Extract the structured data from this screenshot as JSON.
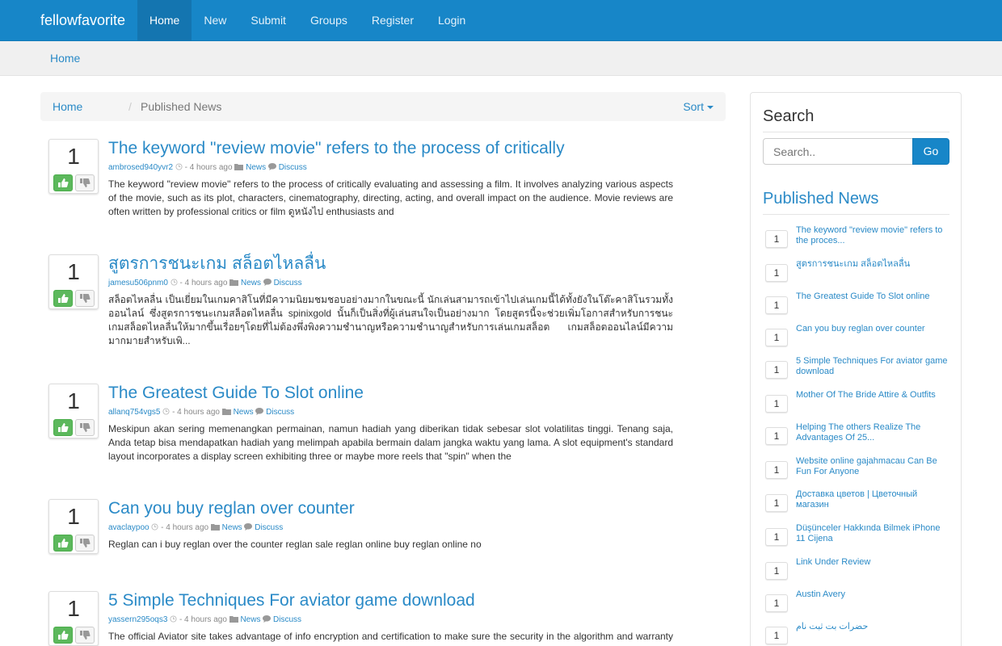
{
  "navbar": {
    "brand": "fellowfavorite",
    "items": [
      {
        "label": "Home",
        "active": true
      },
      {
        "label": "New"
      },
      {
        "label": "Submit"
      },
      {
        "label": "Groups"
      },
      {
        "label": "Register"
      },
      {
        "label": "Login"
      }
    ]
  },
  "top_breadcrumb": {
    "home": "Home"
  },
  "breadcrumb": {
    "home": "Home",
    "separator": "/",
    "current": "Published News",
    "sort_label": "Sort"
  },
  "posts": [
    {
      "votes": "1",
      "title": "The keyword \"review movie\" refers to the process of critically",
      "author": "ambrosed940yvr2",
      "time": "- 4 hours ago",
      "category": "News",
      "discuss": "Discuss",
      "body": "The keyword \"review movie\" refers to the process of critically evaluating and assessing a film. It involves analyzing various aspects of the movie, such as its plot, characters, cinematography, directing, acting, and overall impact on the audience. Movie reviews are often written by professional critics or film ดูหนังไป enthusiasts and"
    },
    {
      "votes": "1",
      "title": "สูตรการชนะเกม สล็อตไหลลื่น",
      "author": "jamesu506pnm0",
      "time": "- 4 hours ago",
      "category": "News",
      "discuss": "Discuss",
      "body": "สล็อตไหลลื่น เป็นเยี่ยมในเกมคาสิโนที่มีความนิยมชมชอบอย่างมากในขณะนี้ นักเล่นสามารถเข้าไปเล่นเกมนี้ได้ทั้งยังในโต๊ะคาสิโนรวมทั้งออนไลน์ ซึ่งสูตรการชนะเกมสล็อตไหลลื่น spinixgold นั้นก็เป็นสิ่งที่ผู้เล่นสนใจเป็นอย่างมาก โดยสูตรนี้จะช่วยเพิ่มโอกาสสำหรับการชนะเกมสล็อตไหลลื่นให้มากขึ้นเรื่อยๆโดยที่ไม่ต้องพึ่งพิงความชำนาญหรือความชำนาญสำหรับการเล่นเกมสล็อต เกมสล็อตออนไลน์มีความมากมายสำหรับเพิ..."
    },
    {
      "votes": "1",
      "title": "The Greatest Guide To Slot online",
      "author": "allanq754vgs5",
      "time": "- 4 hours ago",
      "category": "News",
      "discuss": "Discuss",
      "body": "Meskipun akan sering memenangkan permainan, namun hadiah yang diberikan tidak sebesar slot volatilitas tinggi. Tenang saja, Anda tetap bisa mendapatkan hadiah yang melimpah apabila bermain dalam jangka waktu yang lama. A slot equipment's standard layout incorporates a display screen exhibiting three or maybe more reels that \"spin\" when the"
    },
    {
      "votes": "1",
      "title": "Can you buy reglan over counter",
      "author": "avaclaypoo",
      "time": "- 4 hours ago",
      "category": "News",
      "discuss": "Discuss",
      "body": "Reglan can i buy reglan over the counter reglan sale reglan online buy reglan online no"
    },
    {
      "votes": "1",
      "title": "5 Simple Techniques For aviator game download",
      "author": "yassern295oqs3",
      "time": "- 4 hours ago",
      "category": "News",
      "discuss": "Discuss",
      "body": "The official Aviator site takes advantage of info encryption and certification to make sure the security in the algorithm and warranty its"
    }
  ],
  "sidebar": {
    "search_title": "Search",
    "search_placeholder": "Search..",
    "go_label": "Go",
    "news_title": "Published News",
    "items": [
      {
        "count": "1",
        "title": "The keyword \"review movie\" refers to the proces..."
      },
      {
        "count": "1",
        "title": "สูตรการชนะเกม สล็อตไหลลื่น"
      },
      {
        "count": "1",
        "title": "The Greatest Guide To Slot online"
      },
      {
        "count": "1",
        "title": "Can you buy reglan over counter"
      },
      {
        "count": "1",
        "title": "5 Simple Techniques For aviator game download"
      },
      {
        "count": "1",
        "title": "Mother Of The Bride Attire & Outfits"
      },
      {
        "count": "1",
        "title": "Helping The others Realize The Advantages Of 25..."
      },
      {
        "count": "1",
        "title": "Website online gajahmacau Can Be Fun For Anyone"
      },
      {
        "count": "1",
        "title": "Доставка цветов | Цветочный магазин"
      },
      {
        "count": "1",
        "title": "Düşünceler Hakkında Bilmek iPhone 11 Cijena"
      },
      {
        "count": "1",
        "title": "Link Under Review"
      },
      {
        "count": "1",
        "title": "Austin Avery"
      },
      {
        "count": "1",
        "title": "حضرات بت ثبت نام"
      }
    ]
  },
  "colors": {
    "navbar": "#1786c8",
    "link": "#2a8ac7",
    "upvote": "#5cb85c"
  },
  "icons": [
    "thumbs-up-icon",
    "thumbs-down-icon",
    "clock-icon",
    "folder-icon",
    "comment-icon"
  ]
}
